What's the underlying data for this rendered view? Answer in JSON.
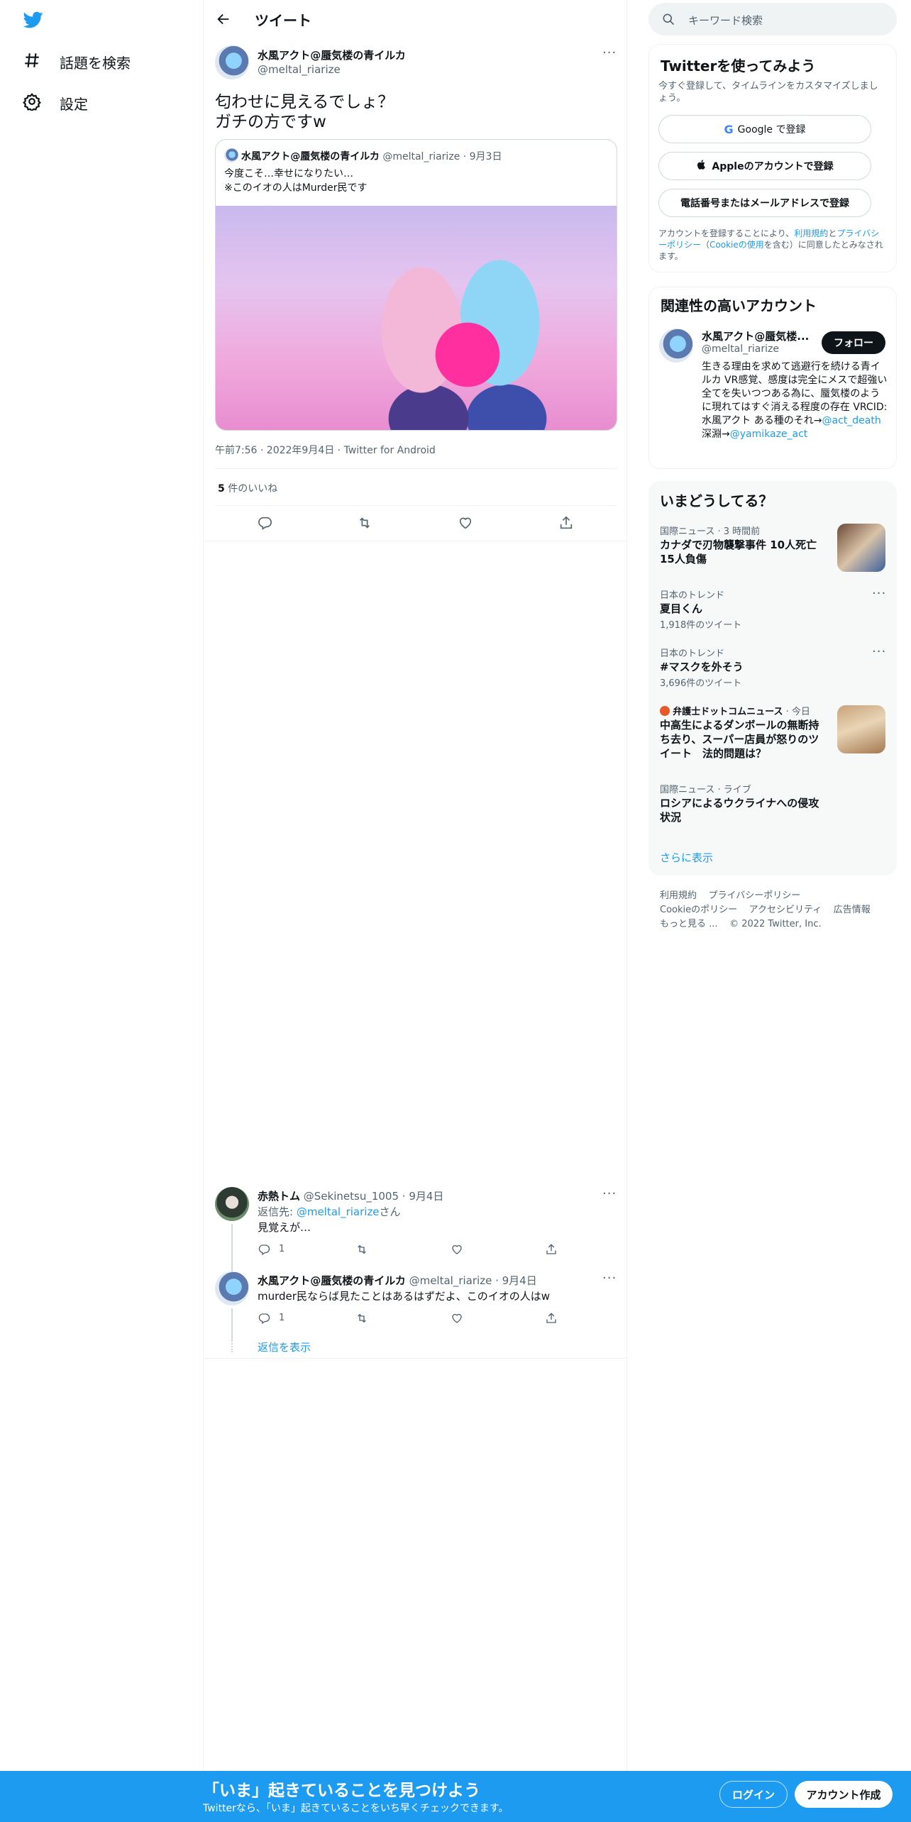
{
  "colors": {
    "accent": "#1d9bf0",
    "text": "#0f1419",
    "secondary": "#536471",
    "border": "#eff3f4"
  },
  "leftnav": {
    "logo": "twitter-bird-icon",
    "items": [
      {
        "label": "話題を検索",
        "icon": "hashtag-icon"
      },
      {
        "label": "設定",
        "icon": "gear-icon"
      }
    ]
  },
  "header": {
    "title": "ツイート"
  },
  "tweet": {
    "name": "水風アクト@蜃気楼の青イルカ",
    "handle": "@meltal_riarize",
    "text_line1": "匂わせに見えるでしょ？",
    "text_line2": "ガチの方ですw",
    "quote": {
      "name": "水風アクト@蜃気楼の青イルカ",
      "handle": "@meltal_riarize",
      "date": "· 9月3日",
      "line1": "今度こそ…幸せになりたい…",
      "line2": "※このイオの人はMurder民です"
    },
    "meta": "午前7:56 · 2022年9月4日 · Twitter for Android",
    "likes_count": "5",
    "likes_label": " 件のいいね"
  },
  "replies": [
    {
      "name": "赤熱トム",
      "handle": "@Sekinetsu_1005",
      "date": "· 9月4日",
      "reply_prefix": "返信先: ",
      "reply_to": "@meltal_riarize",
      "reply_suffix": "さん",
      "text": "見覚えが…",
      "reply_count": "1"
    },
    {
      "name": "水風アクト@蜃気楼の青イルカ",
      "handle": "@meltal_riarize",
      "date": "· 9月4日",
      "text": "murder民ならば見たことはあるはずだよ、このイオの人はw",
      "reply_count": "1"
    }
  ],
  "show_replies": "返信を表示",
  "search": {
    "placeholder": "キーワード検索"
  },
  "signup": {
    "title": "Twitterを使ってみよう",
    "subtitle": "今すぐ登録して、タイムラインをカスタマイズしましょう。",
    "google": "Google で登録",
    "apple": "Appleのアカウントで登録",
    "phone": "電話番号またはメールアドレスで登録",
    "legal_1": "アカウントを登録することにより、",
    "legal_terms": "利用規約",
    "legal_2": "と",
    "legal_privacy": "プライバシーポリシー",
    "legal_3": "（",
    "legal_cookie": "Cookieの使用",
    "legal_4": "を含む）に同意したとみなされます。"
  },
  "related": {
    "title": "関連性の高いアカウント",
    "name": "水風アクト@蜃気楼...",
    "handle": "@meltal_riarize",
    "follow": "フォロー",
    "bio_1": "生きる理由を求めて逃避行を続ける青イルカ VR感覚、感度は完全にメスで超強い 全てを失いつつある為に、蜃気楼のように現れてはすぐ消える程度の存在 VRCID:水風アクト ある種のそれ→",
    "bio_link1": "@act_death",
    "bio_2": " 深淵→",
    "bio_link2": "@yamikaze_act"
  },
  "trends": {
    "title": "いまどうしてる？",
    "items": [
      {
        "context": "国際ニュース · 3 時間前",
        "title": "カナダで刃物襲撃事件 10人死亡 15人負傷"
      },
      {
        "context": "日本のトレンド",
        "title": "夏目くん",
        "count": "1,918件のツイート"
      },
      {
        "context": "日本のトレンド",
        "title": "#マスクを外そう",
        "count": "3,696件のツイート"
      },
      {
        "context_source": "弁護士ドットコムニュース",
        "context_time": " · 今日",
        "title": "中高生によるダンボールの無断持ち去り、スーパー店員が怒りのツイート　法的問題は？"
      },
      {
        "context": "国際ニュース · ライブ",
        "title": "ロシアによるウクライナへの侵攻状況"
      }
    ],
    "show_more": "さらに表示"
  },
  "footer": {
    "links_row1": [
      "利用規約",
      "プライバシーポリシー"
    ],
    "links_row2": [
      "Cookieのポリシー",
      "アクセシビリティ",
      "広告情報"
    ],
    "more": "もっと見る ...",
    "copyright": "© 2022 Twitter, Inc."
  },
  "bottombar": {
    "headline": "「いま」起きていることを見つけよう",
    "sub": "Twitterなら、「いま」起きていることをいち早くチェックできます。",
    "login": "ログイン",
    "signup": "アカウント作成"
  }
}
